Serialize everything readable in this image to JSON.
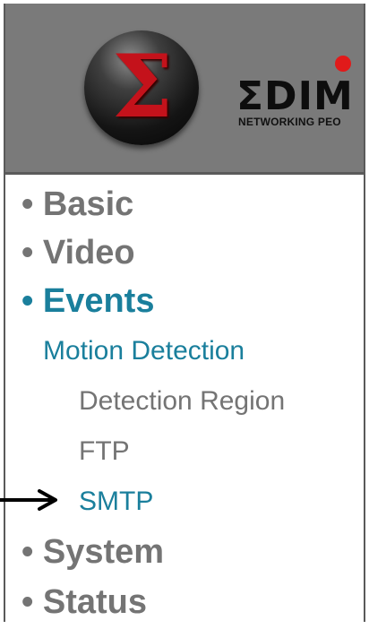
{
  "header": {
    "logo_symbol": "Σ",
    "brand": "ΣDIM",
    "tagline": "NETWORKING PEO",
    "colors": {
      "background": "#7a7a7a",
      "logo_red": "#c4121b",
      "brand_dot": "#e11a1a"
    }
  },
  "nav": {
    "items": [
      {
        "label": "• Basic"
      },
      {
        "label": "• Video"
      },
      {
        "label": "• Events"
      },
      {
        "label": "• System"
      },
      {
        "label": "• Status"
      }
    ],
    "events_sub": {
      "motion_detection": "Motion Detection",
      "children": [
        {
          "label": "Detection Region"
        },
        {
          "label": "FTP"
        },
        {
          "label": "SMTP"
        }
      ]
    },
    "colors": {
      "inactive": "#747474",
      "active": "#1a7f9c"
    }
  },
  "annotation": {
    "icon": "arrow-right-icon"
  }
}
